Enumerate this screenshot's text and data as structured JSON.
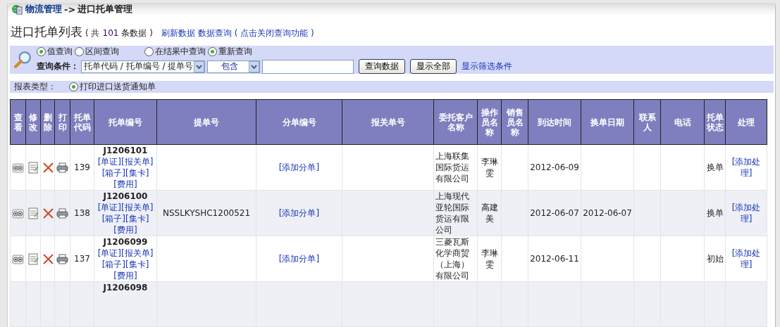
{
  "breadcrumb": {
    "parent": "物流管理",
    "separator": "->",
    "current": "进口托单管理"
  },
  "heading": {
    "title": "进口托单列表",
    "count_prefix": "( 共",
    "count": "101",
    "count_suffix": "条数据 )",
    "links": [
      "刷新数据",
      "数据查询 ( 点击关闭查询功能 )"
    ]
  },
  "query": {
    "modes": [
      {
        "label": "值查询",
        "selected": true
      },
      {
        "label": "区间查询",
        "selected": false
      }
    ],
    "scopes": [
      {
        "label": "在结果中查询",
        "selected": false
      },
      {
        "label": "重新查询",
        "selected": true
      }
    ],
    "condition_label": "查询条件：",
    "field_select": "托单代码 / 托单编号 / 提单号",
    "operator_select": "包含",
    "buttons": [
      "查询数据",
      "显示全部"
    ],
    "filter_link": "显示筛选条件"
  },
  "report": {
    "label": "报表类型：",
    "options": [
      {
        "label": "打印进口送货通知单",
        "selected": true
      }
    ]
  },
  "table": {
    "columns": [
      "查看",
      "修改",
      "删除",
      "打印",
      "托单代码",
      "托单编号",
      "提单号",
      "分单编号",
      "报关单号",
      "委托客户名称",
      "操作员名称",
      "销售员名称",
      "到达时间",
      "换单日期",
      "联系人",
      "电话",
      "托单状态",
      "处理"
    ],
    "rows": [
      {
        "code": "139",
        "order_no": "J1206101",
        "links": [
          "[单证]",
          "[报关单]",
          "[箱子]",
          "[集卡]",
          "[费用]"
        ],
        "bl_no": "",
        "sub_link": "[添加分单]",
        "customs_no": "",
        "customer": "上海联集国际货运有限公司",
        "operator": "李琳雯",
        "sales": "",
        "arrival": "2012-06-09",
        "exchange_date": "",
        "contact": "",
        "phone": "",
        "status": "换单",
        "action": "[添加处理]"
      },
      {
        "code": "138",
        "order_no": "J1206100",
        "links": [
          "[单证]",
          "[报关单]",
          "[箱子]",
          "[集卡]",
          "[费用]"
        ],
        "bl_no": "NSSLKYSHC1200521",
        "sub_link": "[添加分单]",
        "customs_no": "",
        "customer": "上海现代亚轮国际货运有限公司",
        "operator": "高建美",
        "sales": "",
        "arrival": "2012-06-07",
        "exchange_date": "2012-06-07",
        "contact": "",
        "phone": "",
        "status": "换单",
        "action": "[添加处理]"
      },
      {
        "code": "137",
        "order_no": "J1206099",
        "links": [
          "[单证]",
          "[报关单]",
          "[箱子]",
          "[集卡]",
          "[费用]"
        ],
        "bl_no": "",
        "sub_link": "[添加分单]",
        "customs_no": "",
        "customer": "三菱瓦斯化学商贸（上海）有限公司",
        "operator": "李琳雯",
        "sales": "",
        "arrival": "2012-06-11",
        "exchange_date": "",
        "contact": "",
        "phone": "",
        "status": "初始",
        "action": "[添加处理]"
      },
      {
        "order_no": "J1206098"
      }
    ]
  }
}
